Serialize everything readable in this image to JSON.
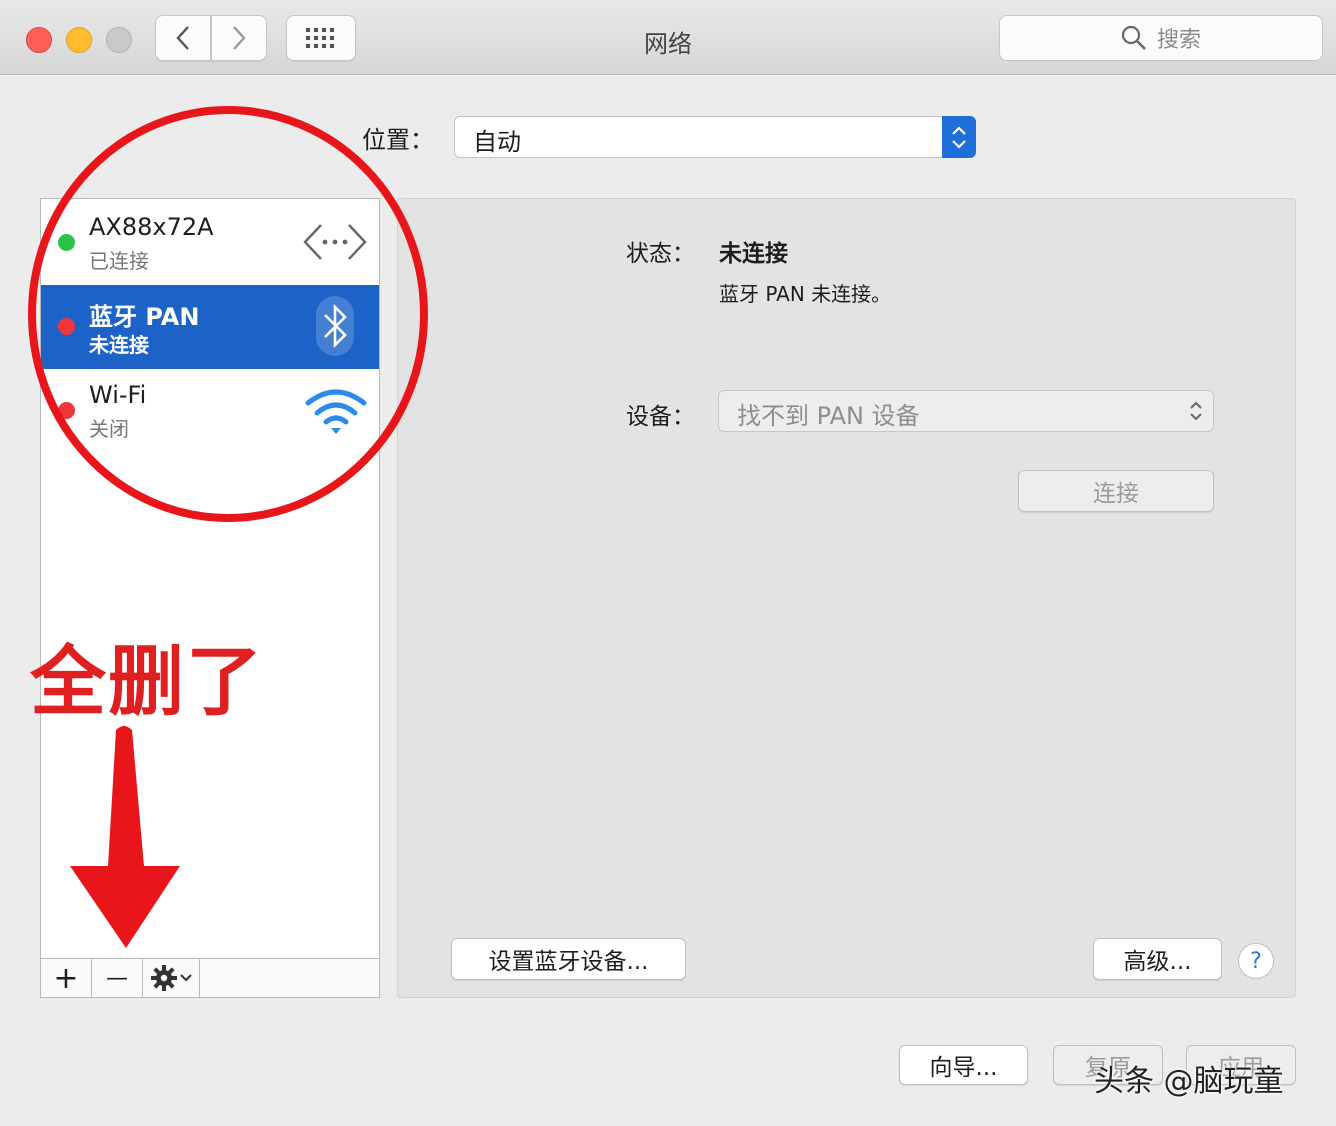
{
  "window": {
    "title": "网络",
    "search_placeholder": "搜索",
    "traffic_light_colors": [
      "#fe5f57",
      "#febc2e",
      "#c9c9c9"
    ]
  },
  "location": {
    "label": "位置：",
    "value": "自动"
  },
  "services": [
    {
      "name": "AX88x72A",
      "status": "已连接",
      "status_color": "#29c24a",
      "icon": "ethernet-icon",
      "selected": false
    },
    {
      "name": "蓝牙 PAN",
      "status": "未连接",
      "status_color": "#f0353b",
      "icon": "bluetooth-icon",
      "selected": true
    },
    {
      "name": "Wi-Fi",
      "status": "关闭",
      "status_color": "#f0353b",
      "icon": "wifi-icon",
      "selected": false
    }
  ],
  "sidebar_toolbar": {
    "add": "+",
    "remove": "—"
  },
  "detail": {
    "status_label": "状态：",
    "status_value": "未连接",
    "status_desc": "蓝牙 PAN 未连接。",
    "device_label": "设备：",
    "device_value": "找不到 PAN 设备",
    "connect_button": "连接",
    "setup_bluetooth_button": "设置蓝牙设备...",
    "advanced_button": "高级...",
    "help_button": "?"
  },
  "footer": {
    "assistant_button": "向导...",
    "revert_button": "复原",
    "apply_button": "应用"
  },
  "annotations": {
    "text": "全删了",
    "color": "#e02020"
  },
  "watermark": "头条 @脑玩童"
}
